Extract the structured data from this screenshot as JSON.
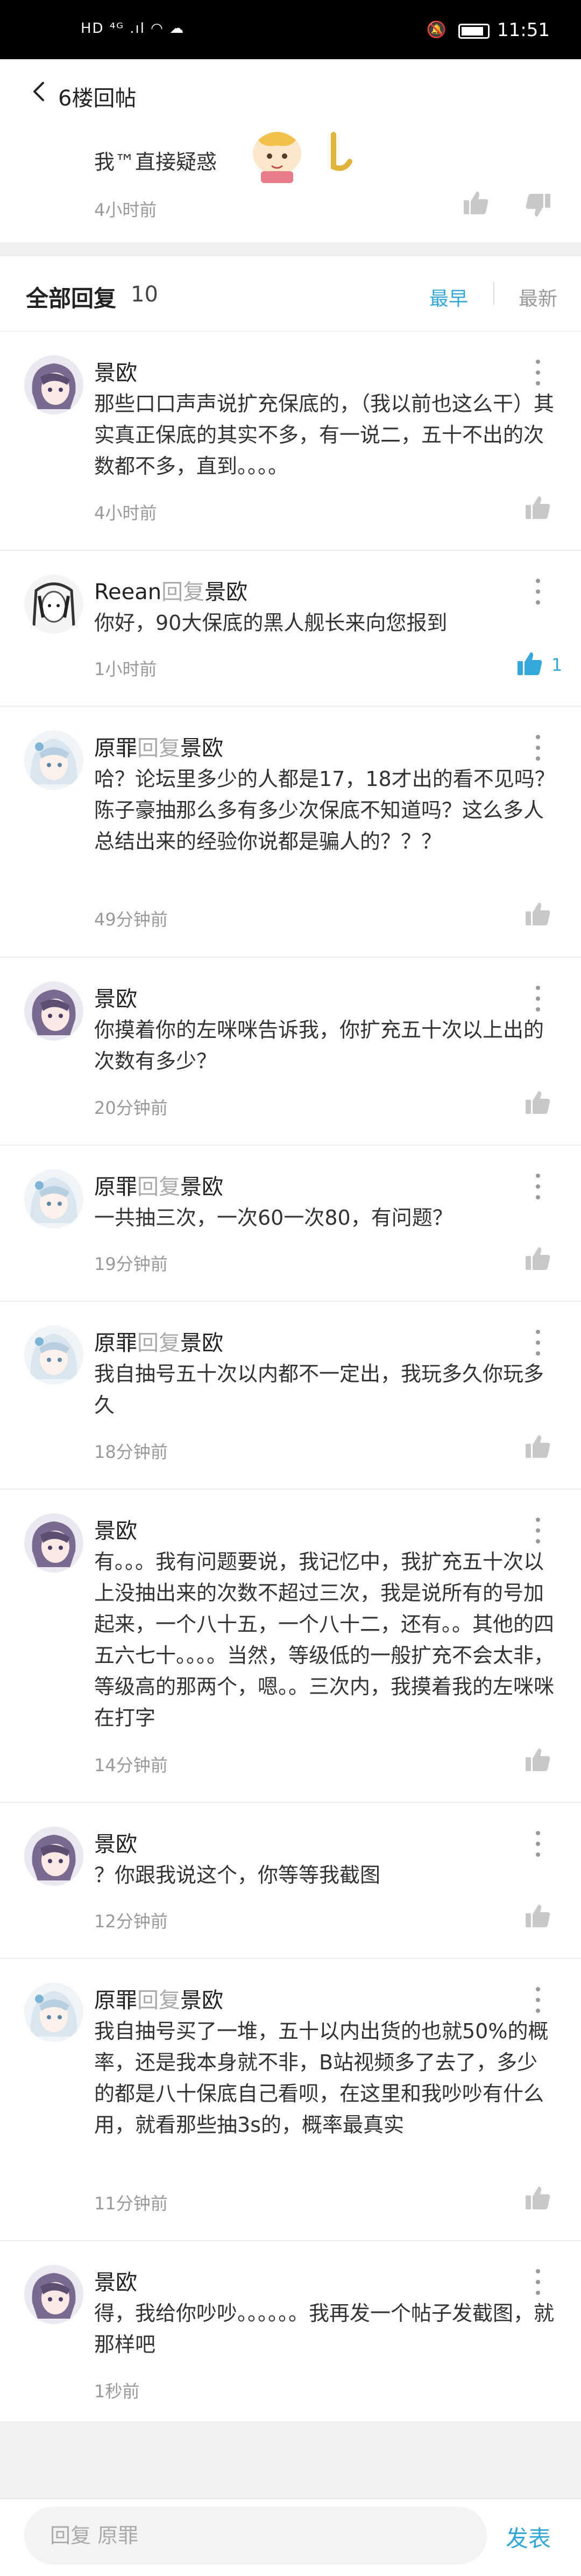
{
  "status_bar": {
    "left": "HD ⁴ᴳ .ıl ◠ ☁",
    "time": "11:51"
  },
  "header": {
    "title": "6楼回帖"
  },
  "floor": {
    "text": "我™直接疑惑",
    "time": "4小时前"
  },
  "replies_header": {
    "label": "全部回复",
    "count": "10",
    "sort_earliest": "最早",
    "sort_latest": "最新"
  },
  "reply_word": "回复",
  "replies": [
    {
      "user": "景欧",
      "avatar": "purple",
      "reply_to": "",
      "text": "那些口口声声说扩充保底的，（我以前也这么干）其实真正保底的其实不多，有一说二，五十不出的次数都不多，直到。。。。",
      "time": "4小时前",
      "likes": ""
    },
    {
      "user": "Reean",
      "avatar": "sketch",
      "reply_to": "景欧",
      "text": "你好，90大保底的黑人舰长来向您报到",
      "time": "1小时前",
      "likes": "1"
    },
    {
      "user": "原罪",
      "avatar": "blue",
      "reply_to": "景欧",
      "text": "哈？论坛里多少的人都是17，18才出的看不见吗？陈子豪抽那么多有多少次保底不知道吗？这么多人总结出来的经验你说都是骗人的？？？",
      "time": "49分钟前",
      "likes": ""
    },
    {
      "user": "景欧",
      "avatar": "purple",
      "reply_to": "",
      "text": "你摸着你的左咪咪告诉我，你扩充五十次以上出的次数有多少？",
      "time": "20分钟前",
      "likes": ""
    },
    {
      "user": "原罪",
      "avatar": "blue",
      "reply_to": "景欧",
      "text": "一共抽三次，一次60一次80，有问题？",
      "time": "19分钟前",
      "likes": ""
    },
    {
      "user": "原罪",
      "avatar": "blue",
      "reply_to": "景欧",
      "text": "我自抽号五十次以内都不一定出，我玩多久你玩多久",
      "time": "18分钟前",
      "likes": ""
    },
    {
      "user": "景欧",
      "avatar": "purple",
      "reply_to": "",
      "text": "有。。。我有问题要说，我记忆中，我扩充五十次以上没抽出来的次数不超过三次，我是说所有的号加起来，一个八十五，一个八十二，还有。。其他的四五六七十。。。。当然，等级低的一般扩充不会太非，等级高的那两个，嗯。。三次内，我摸着我的左咪咪在打字",
      "time": "14分钟前",
      "likes": ""
    },
    {
      "user": "景欧",
      "avatar": "purple",
      "reply_to": "",
      "text": "？你跟我说这个，你等等我截图",
      "time": "12分钟前",
      "likes": ""
    },
    {
      "user": "原罪",
      "avatar": "blue",
      "reply_to": "景欧",
      "text": "我自抽号买了一堆，五十以内出货的也就50%的概率，还是我本身就不非，B站视频多了去了，多少的都是八十保底自己看呗，在这里和我吵吵有什么用，就看那些抽3s的，概率最真实",
      "time": "11分钟前",
      "likes": ""
    },
    {
      "user": "景欧",
      "avatar": "purple",
      "reply_to": "",
      "text": "得，我给你吵吵。。。。。。我再发一个帖子发截图，就那样吧",
      "time": "1秒前",
      "likes": ""
    }
  ],
  "input": {
    "placeholder": "回复 原罪",
    "send_label": "发表"
  },
  "colors": {
    "accent": "#35a7d8",
    "meta": "#999999",
    "divider": "#efefef"
  }
}
